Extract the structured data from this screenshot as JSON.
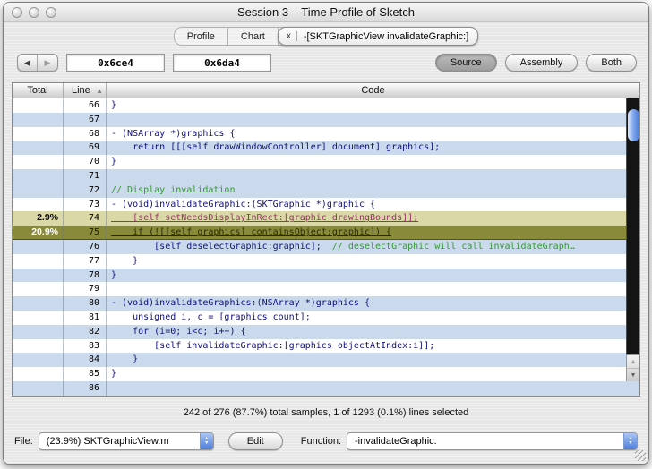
{
  "window": {
    "title": "Session 3 – Time Profile of Sketch"
  },
  "tabs": {
    "profile": "Profile",
    "chart": "Chart",
    "active_label": "-[SKTGraphicView invalidateGraphic:]",
    "close_glyph": "x"
  },
  "toolbar": {
    "back_glyph": "◀",
    "forward_glyph": "▶",
    "address_start": "0x6ce4",
    "address_end": "0x6da4",
    "source_label": "Source",
    "assembly_label": "Assembly",
    "both_label": "Both"
  },
  "table": {
    "columns": [
      "Total",
      "Line",
      "Code"
    ],
    "sort_glyph": "▲",
    "rows": [
      {
        "total": "",
        "line": "66",
        "shade": "white",
        "code": [
          {
            "t": "}",
            "k": "code"
          }
        ]
      },
      {
        "total": "",
        "line": "67",
        "shade": "blue",
        "code": []
      },
      {
        "total": "",
        "line": "68",
        "shade": "white",
        "code": [
          {
            "t": "- (NSArray *)graphics {",
            "k": "code"
          }
        ]
      },
      {
        "total": "",
        "line": "69",
        "shade": "blue",
        "code": [
          {
            "t": "    return [[[self drawWindowController] document] graphics];",
            "k": "code"
          }
        ]
      },
      {
        "total": "",
        "line": "70",
        "shade": "white",
        "code": [
          {
            "t": "}",
            "k": "code"
          }
        ]
      },
      {
        "total": "",
        "line": "71",
        "shade": "blue",
        "code": []
      },
      {
        "total": "",
        "line": "72",
        "shade": "blue",
        "code": [
          {
            "t": "// Display invalidation",
            "k": "comment"
          }
        ]
      },
      {
        "total": "",
        "line": "73",
        "shade": "white",
        "code": [
          {
            "t": "- (void)invalidateGraphic:(SKTGraphic *)graphic {",
            "k": "code"
          }
        ]
      },
      {
        "total": "2.9%",
        "line": "74",
        "shade": "hot",
        "code": [
          {
            "t": "    [self setNeedsDisplayInRect:[graphic drawingBounds]];",
            "k": "hotlink"
          }
        ]
      },
      {
        "total": "20.9%",
        "line": "75",
        "shade": "selected",
        "code": [
          {
            "t": "    if (![[self graphics] containsObject:graphic]) {",
            "k": "selectedlink"
          }
        ]
      },
      {
        "total": "",
        "line": "76",
        "shade": "blue",
        "code": [
          {
            "t": "        [self deselectGraphic:graphic];  ",
            "k": "code"
          },
          {
            "t": "// deselectGraphic will call invalidateGraph…",
            "k": "comment"
          }
        ]
      },
      {
        "total": "",
        "line": "77",
        "shade": "white",
        "code": [
          {
            "t": "    }",
            "k": "code"
          }
        ]
      },
      {
        "total": "",
        "line": "78",
        "shade": "blue",
        "code": [
          {
            "t": "}",
            "k": "code"
          }
        ]
      },
      {
        "total": "",
        "line": "79",
        "shade": "white",
        "code": []
      },
      {
        "total": "",
        "line": "80",
        "shade": "blue",
        "code": [
          {
            "t": "- (void)invalidateGraphics:(NSArray *)graphics {",
            "k": "code"
          }
        ]
      },
      {
        "total": "",
        "line": "81",
        "shade": "white",
        "code": [
          {
            "t": "    unsigned i, c = [graphics count];",
            "k": "code"
          }
        ]
      },
      {
        "total": "",
        "line": "82",
        "shade": "blue",
        "code": [
          {
            "t": "    for (i=0; i<c; i++) {",
            "k": "code"
          }
        ]
      },
      {
        "total": "",
        "line": "83",
        "shade": "white",
        "code": [
          {
            "t": "        [self invalidateGraphic:[graphics objectAtIndex:i]];",
            "k": "code"
          }
        ]
      },
      {
        "total": "",
        "line": "84",
        "shade": "blue",
        "code": [
          {
            "t": "    }",
            "k": "code"
          }
        ]
      },
      {
        "total": "",
        "line": "85",
        "shade": "white",
        "code": [
          {
            "t": "}",
            "k": "code"
          }
        ]
      },
      {
        "total": "",
        "line": "86",
        "shade": "blue",
        "code": []
      }
    ]
  },
  "scrollbar": {
    "up_glyph": "▲",
    "down_glyph": "▼"
  },
  "status": "242 of 276 (87.7%) total samples, 1 of 1293 (0.1%) lines selected",
  "footer": {
    "file_label": "File:",
    "file_value": "(23.9%) SKTGraphicView.m",
    "edit_label": "Edit",
    "function_label": "Function:",
    "function_value": "-invalidateGraphic:",
    "popup_up": "▲",
    "popup_down": "▼"
  },
  "colors": {
    "row_blue": "#cbd9ec",
    "row_white": "#ffffff",
    "hot_row": "#dbd8a8",
    "selected_row": "#8a8a3b",
    "hot_link": "#993366",
    "selected_link": "#2a2a08",
    "code": "#101080",
    "comment": "#339933"
  }
}
